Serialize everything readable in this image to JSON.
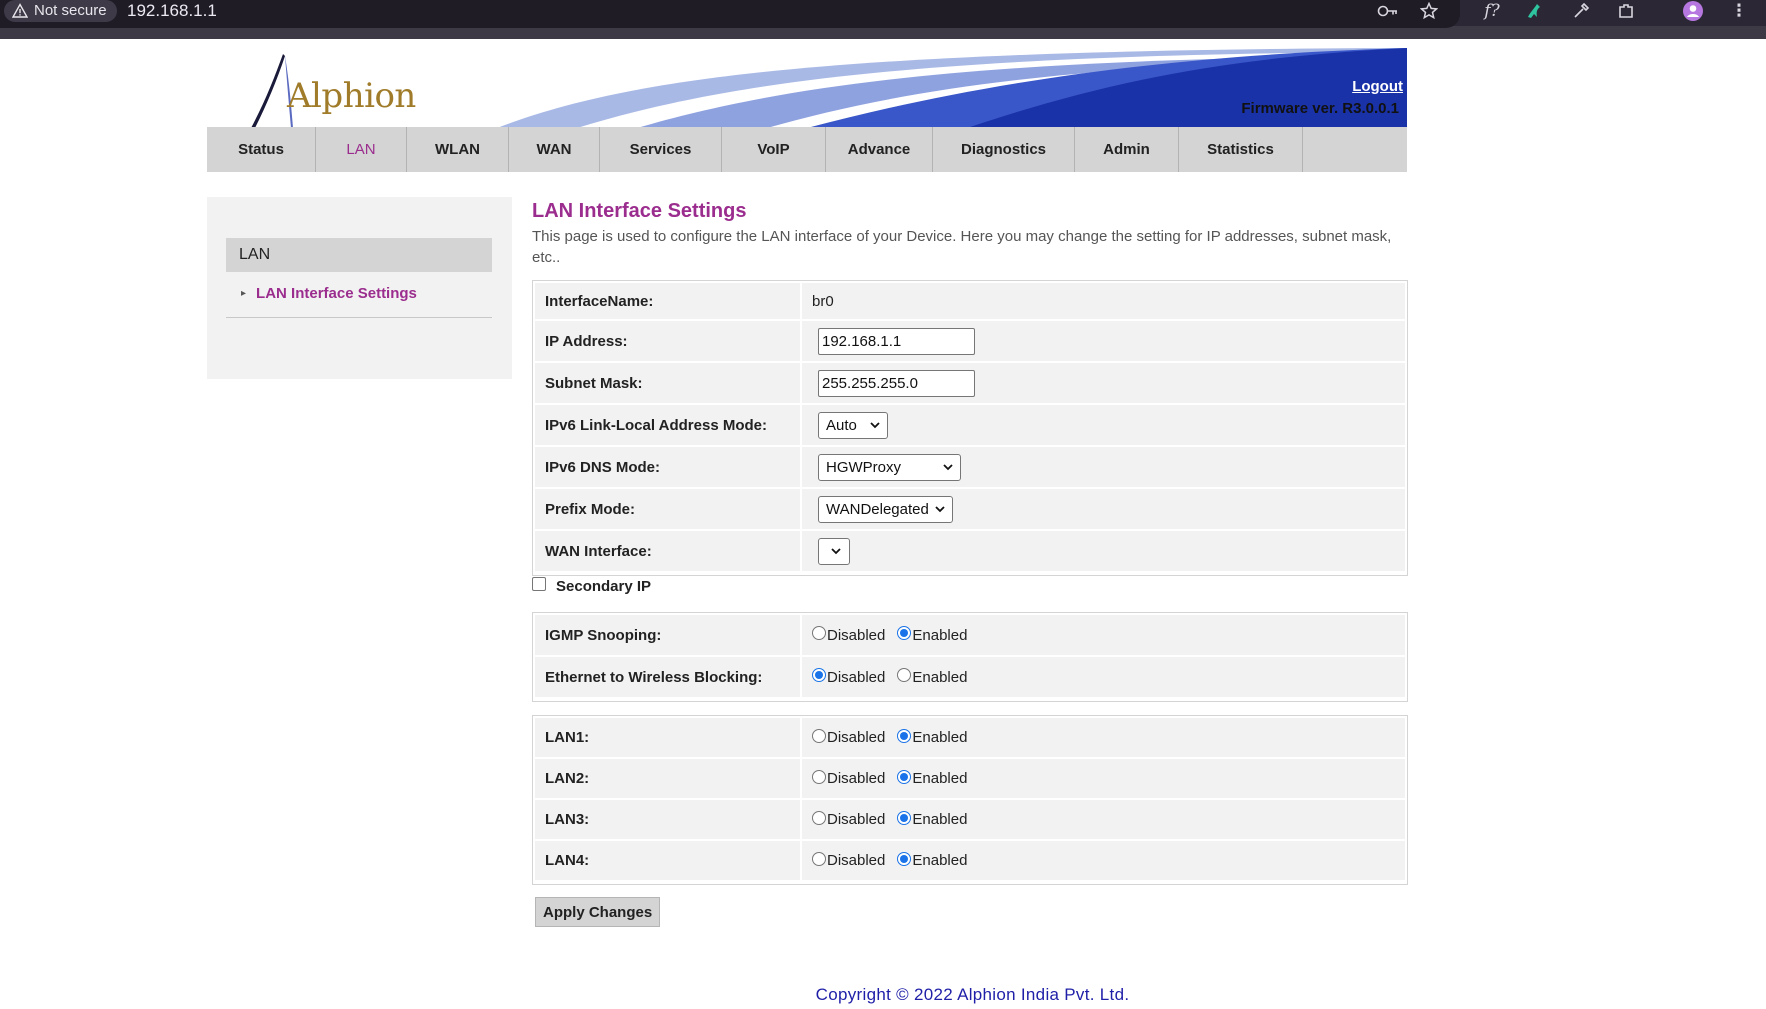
{
  "browser": {
    "security_label": "Not secure",
    "url": "192.168.1.1",
    "icons": [
      "key-icon",
      "star-icon",
      "formula-icon",
      "extension-bird-icon",
      "eyedropper-icon",
      "extensions-icon",
      "profile-icon",
      "more-icon"
    ]
  },
  "banner": {
    "logo_text": "Alphion",
    "logout_label": "Logout",
    "firmware": "Firmware ver. R3.0.0.1"
  },
  "nav": {
    "items": [
      "Status",
      "LAN",
      "WLAN",
      "WAN",
      "Services",
      "VoIP",
      "Advance",
      "Diagnostics",
      "Admin",
      "Statistics"
    ],
    "active": "LAN"
  },
  "sidebar": {
    "heading": "LAN",
    "link": "LAN Interface Settings"
  },
  "main": {
    "title": "LAN Interface Settings",
    "description": "This page is used to configure the LAN interface of your Device. Here you may change the setting for IP addresses, subnet mask, etc..",
    "interface": {
      "name_label": "InterfaceName:",
      "name_value": "br0",
      "ip_label": "IP Address:",
      "ip_value": "192.168.1.1",
      "subnet_label": "Subnet Mask:",
      "subnet_value": "255.255.255.0",
      "ipv6_link_label": "IPv6 Link-Local Address Mode:",
      "ipv6_link_value": "Auto",
      "ipv6_dns_label": "IPv6 DNS Mode:",
      "ipv6_dns_value": "HGWProxy",
      "prefix_label": "Prefix Mode:",
      "prefix_value": "WANDelegated",
      "wan_label": "WAN Interface:",
      "wan_value": ""
    },
    "secondary_ip_label": "Secondary IP",
    "secondary_ip_checked": false,
    "disabled_label": "Disabled",
    "enabled_label": "Enabled",
    "igmp_label": "IGMP Snooping:",
    "igmp_value": "Enabled",
    "eth_block_label": "Ethernet to Wireless Blocking:",
    "eth_block_value": "Disabled",
    "lans": [
      {
        "label": "LAN1:",
        "value": "Enabled"
      },
      {
        "label": "LAN2:",
        "value": "Enabled"
      },
      {
        "label": "LAN3:",
        "value": "Enabled"
      },
      {
        "label": "LAN4:",
        "value": "Enabled"
      }
    ],
    "apply_label": "Apply Changes"
  },
  "footer": "Copyright © 2022 Alphion India Pvt. Ltd.",
  "colors": {
    "accent_purple": "#9b2d8e",
    "banner_blue": "#1a32a8",
    "footer_blue": "#1f1fa8",
    "radio_blue": "#1a73e8"
  }
}
